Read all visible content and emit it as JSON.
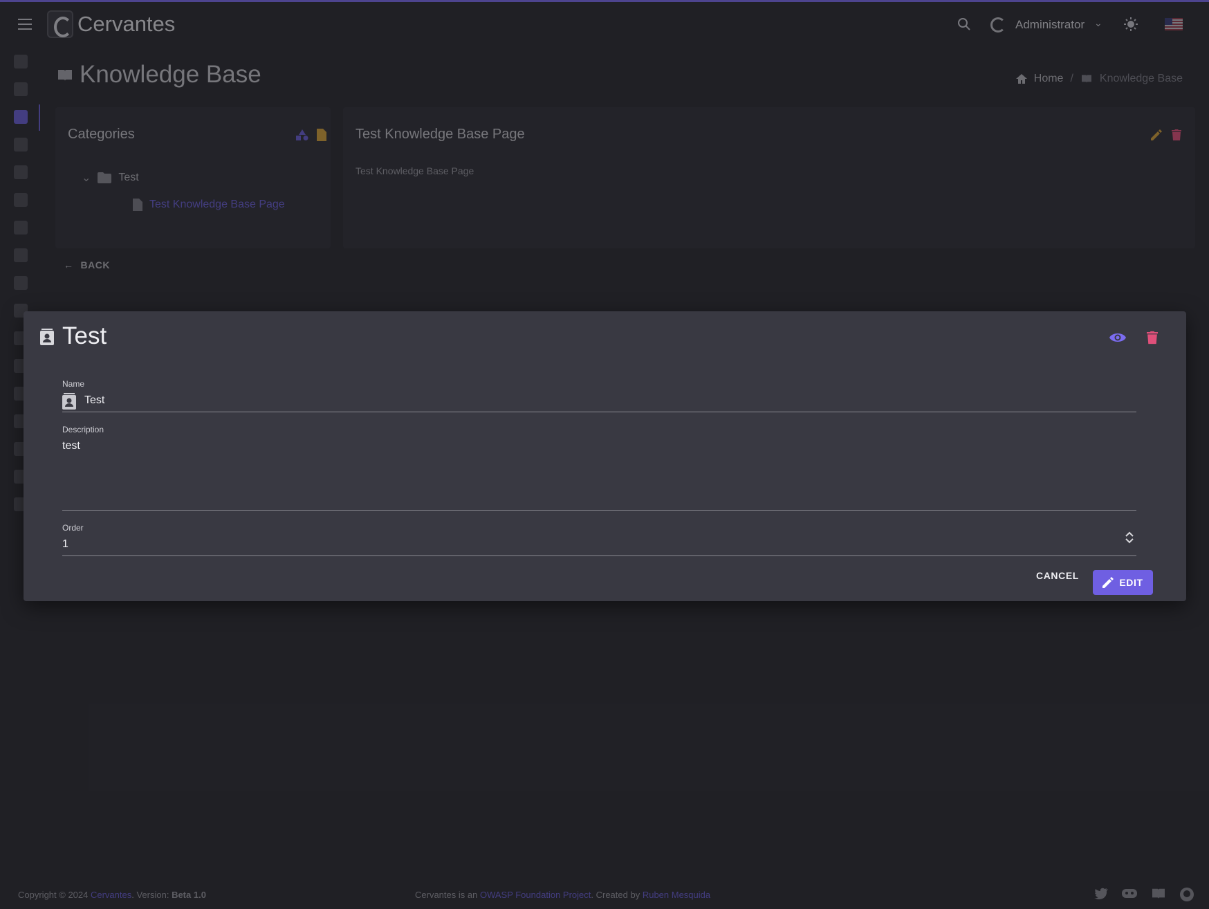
{
  "app": {
    "brand": "Cervantes"
  },
  "topbar": {
    "user_name": "Administrator"
  },
  "page": {
    "title": "Knowledge Base"
  },
  "breadcrumb": {
    "home": "Home",
    "current": "Knowledge Base"
  },
  "categories": {
    "title": "Categories",
    "tree": [
      {
        "label": "Test",
        "children": [
          {
            "label": "Test Knowledge Base Page"
          }
        ]
      }
    ]
  },
  "kb_page": {
    "title": "Test Knowledge Base Page",
    "content": "Test Knowledge Base Page"
  },
  "back_button": {
    "label": "BACK"
  },
  "dialog": {
    "title": "Test",
    "name_label": "Name",
    "name_value": "Test",
    "description_label": "Description",
    "description_value": "test",
    "order_label": "Order",
    "order_value": "1",
    "cancel_label": "CANCEL",
    "edit_label": "EDIT"
  },
  "footer": {
    "copyright_prefix": "Copyright © 2024",
    "brand_link": "Cervantes",
    "version_label": ". Version:",
    "version": "Beta 1.0",
    "mid_prefix": "Cervantes is an",
    "owasp_link": "OWASP Foundation Project",
    "created_by": ". Created by",
    "author_link": "Ruben Mesquida"
  },
  "colors": {
    "accent": "#6f5fe2",
    "danger": "#e0507a",
    "warning": "#d6a23a",
    "background": "#2b2b31",
    "dialog": "#393942"
  },
  "icons": [
    "menu-icon",
    "search-icon",
    "sun-icon",
    "flag-icon",
    "book-icon",
    "eye-icon",
    "trash-icon",
    "contact-icon",
    "pencil-icon"
  ]
}
